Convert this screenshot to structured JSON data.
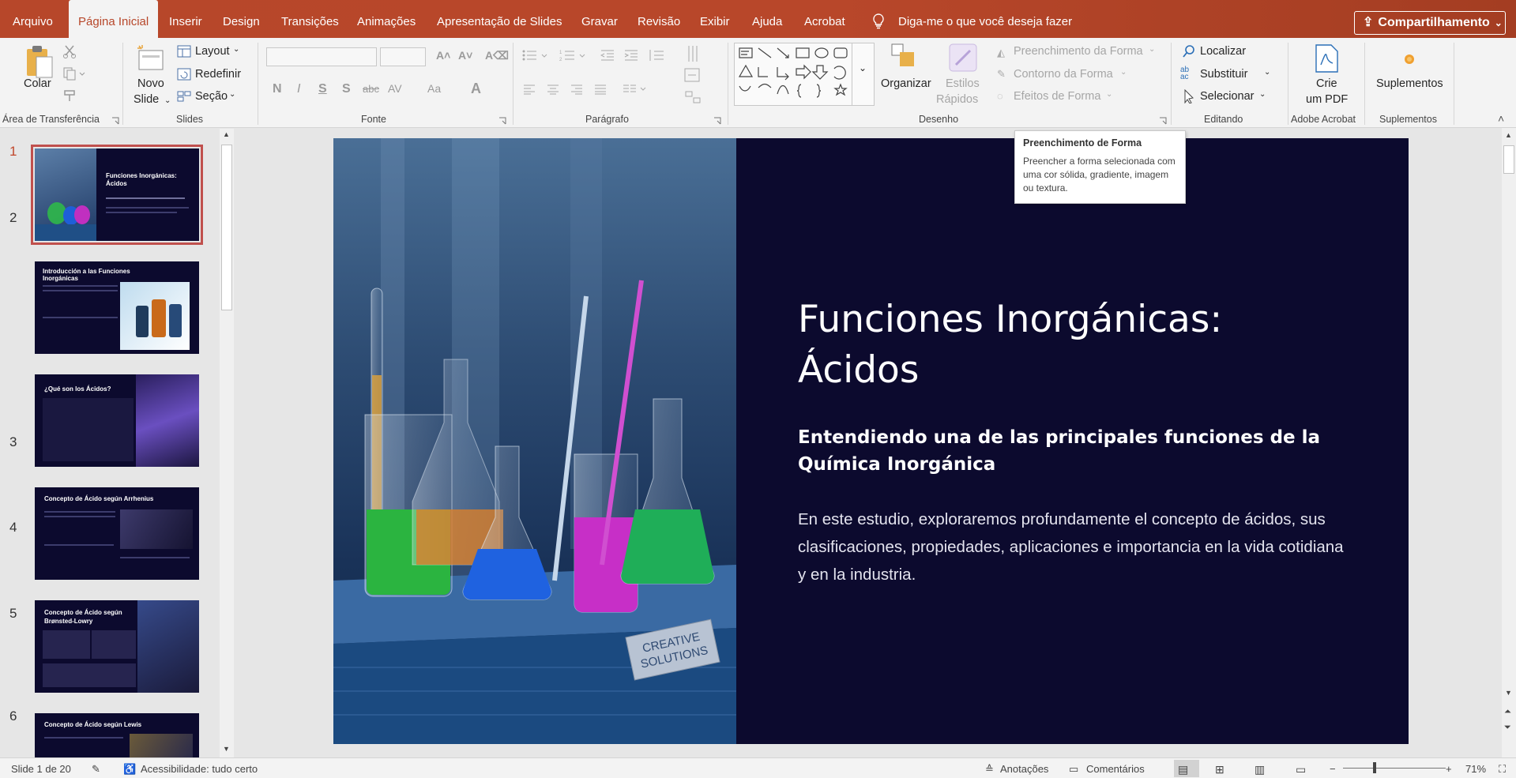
{
  "menubar": {
    "tabs": [
      "Arquivo",
      "Página Inicial",
      "Inserir",
      "Design",
      "Transições",
      "Animações",
      "Apresentação de Slides",
      "Gravar",
      "Revisão",
      "Exibir",
      "Ajuda",
      "Acrobat"
    ],
    "active_tab": "Página Inicial",
    "tell_me": "Diga-me o que você deseja fazer",
    "share": "Compartilhamento"
  },
  "ribbon": {
    "clipboard": {
      "paste": "Colar",
      "label": "Área de Transferência"
    },
    "slides": {
      "new_slide_1": "Novo",
      "new_slide_2": "Slide",
      "layout": "Layout",
      "reset": "Redefinir",
      "section": "Seção",
      "label": "Slides"
    },
    "font": {
      "bold": "N",
      "italic": "I",
      "underline": "S",
      "shadow": "S",
      "strike": "abc",
      "spacing": "AV",
      "case": "Aa",
      "color": "A",
      "label": "Fonte"
    },
    "paragraph": {
      "label": "Parágrafo"
    },
    "drawing": {
      "arrange": "Organizar",
      "quick_styles_1": "Estilos",
      "quick_styles_2": "Rápidos",
      "fill": "Preenchimento da Forma",
      "outline": "Contorno da Forma",
      "effects": "Efeitos de Forma",
      "label": "Desenho"
    },
    "editing": {
      "find": "Localizar",
      "replace": "Substituir",
      "select": "Selecionar",
      "label": "Editando"
    },
    "acrobat": {
      "create_1": "Crie",
      "create_2": "um PDF",
      "label": "Adobe Acrobat"
    },
    "addins": {
      "label": "Suplementos",
      "button": "Suplementos"
    }
  },
  "tooltip": {
    "title": "Preenchimento de Forma",
    "body": "Preencher a forma selecionada com uma cor sólida, gradiente, imagem ou textura."
  },
  "thumbnails": [
    {
      "num": "1",
      "title": "Funciones Inorgánicas: Ácidos"
    },
    {
      "num": "2",
      "title": "Introducción a las Funciones Inorgánicas"
    },
    {
      "num": "3",
      "title": "¿Qué son los Ácidos?"
    },
    {
      "num": "4",
      "title": "Concepto de Ácido según Arrhenius"
    },
    {
      "num": "5",
      "title": "Concepto de Ácido según Brønsted-Lowry"
    },
    {
      "num": "6",
      "title": "Concepto de Ácido según Lewis"
    }
  ],
  "slide": {
    "title_line1": "Funciones Inorgánicas:",
    "title_line2": "Ácidos",
    "subtitle": "Entendiendo una de las principales funciones de la Química Inorgánica",
    "body": "En este estudio, exploraremos profundamente el concepto de ácidos, sus clasificaciones, propiedades, aplicaciones e importancia en la vida cotidiana y en la industria.",
    "label_line1": "CREATIVE",
    "label_line2": "SOLUTIONS"
  },
  "status": {
    "slide": "Slide 1 de 20",
    "accessibility": "Acessibilidade: tudo certo",
    "notes": "Anotações",
    "comments": "Comentários",
    "zoom": "71%"
  },
  "colors": {
    "accent": "#b7472a",
    "slide_bg": "#0c0a2e"
  }
}
